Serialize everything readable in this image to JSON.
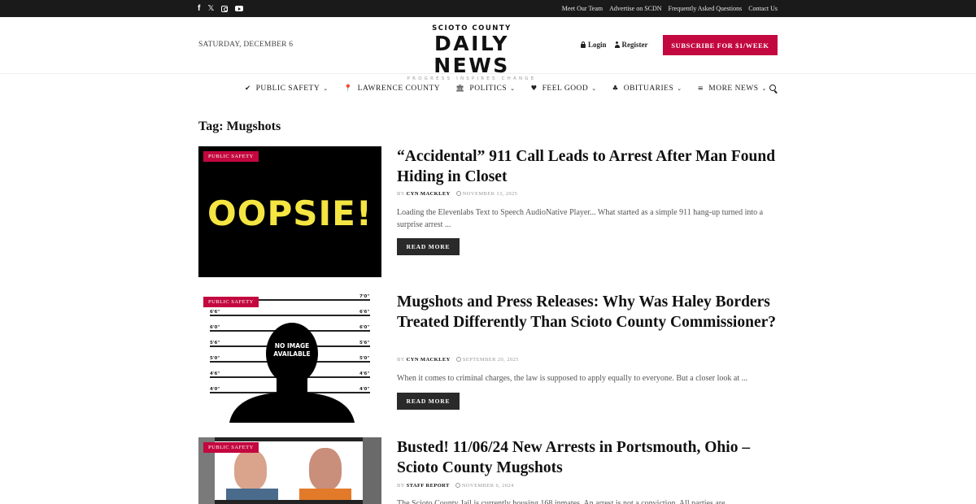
{
  "topbar": {
    "social": [
      "facebook-icon",
      "x-icon",
      "instagram-icon",
      "youtube-icon"
    ],
    "links": [
      "Meet Our Team",
      "Advertise on SCDN",
      "Frequently Asked Questions",
      "Contact Us"
    ]
  },
  "header": {
    "date": "SATURDAY, DECEMBER 6",
    "logo_county": "SCIOTO COUNTY",
    "logo_name": "DAILY NEWS",
    "logo_tagline": "PROGRESS INSPIRES CHANGE",
    "login": "Login",
    "register": "Register",
    "subscribe": "SUBSCRIBE FOR $1/WEEK",
    "brand_color": "#c3073f"
  },
  "nav": {
    "items": [
      {
        "label": "PUBLIC SAFETY",
        "icon": "check-shield-icon"
      },
      {
        "label": "LAWRENCE COUNTY",
        "icon": "map-pin-icon"
      },
      {
        "label": "POLITICS",
        "icon": "institution-icon"
      },
      {
        "label": "FEEL GOOD",
        "icon": "heart-icon"
      },
      {
        "label": "OBITUARIES",
        "icon": "tree-icon"
      },
      {
        "label": "MORE NEWS",
        "icon": "menu-icon"
      }
    ]
  },
  "page": {
    "tag_title": "Tag: Mugshots"
  },
  "articles": [
    {
      "category": "PUBLIC SAFETY",
      "image_text": "OOPSIE!",
      "title": "“Accidental” 911 Call Leads to Arrest After Man Found Hiding in Closet",
      "by": "BY",
      "author": "CYN MACKLEY",
      "date": "NOVEMBER 13, 2025",
      "excerpt": "Loading the Elevenlabs Text to Speech AudioNative Player... What started as a simple 911 hang-up turned into a surprise arrest ...",
      "read_more": "READ MORE"
    },
    {
      "category": "PUBLIC SAFETY",
      "image_text": "NO IMAGE AVAILABLE",
      "height_labels": [
        "7'0\"",
        "6'6\"",
        "6'0\"",
        "5'6\"",
        "5'0\"",
        "4'6\"",
        "4'0\""
      ],
      "title": "Mugshots and Press Releases: Why Was Haley Borders Treated Differently Than Scioto County Commissioner?",
      "by": "BY",
      "author": "CYN MACKLEY",
      "date": "SEPTEMBER 20, 2025",
      "excerpt": "When it comes to criminal charges, the law is supposed to apply equally to everyone. But a closer look at ...",
      "read_more": "READ MORE"
    },
    {
      "category": "PUBLIC SAFETY",
      "title": "Busted! 11/06/24 New Arrests in Portsmouth, Ohio – Scioto County Mugshots",
      "by": "BY",
      "author": "STAFF REPORT",
      "date": "NOVEMBER 6, 2024",
      "excerpt": "The Scioto County Jail is currently housing 168 inmates. An arrest is not a conviction. All parties are ..."
    }
  ]
}
